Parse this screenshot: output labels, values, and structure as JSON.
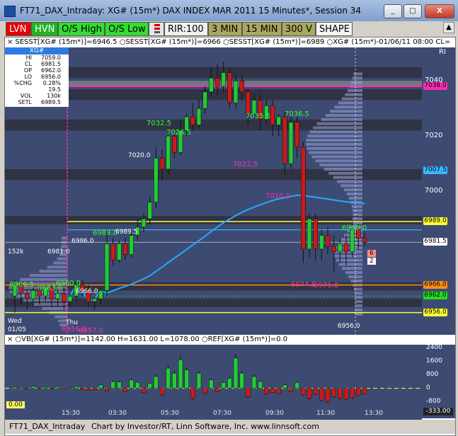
{
  "window": {
    "title": "FT71_DAX_Intraday: XG# (15m*) DAX INDEX MAR 2011 15 Minutes*, Session 34",
    "min_label": "_",
    "max_label": "□",
    "close_label": "X"
  },
  "toolbar": {
    "buttons": [
      "LVN",
      "HVN",
      "O/S High",
      "O/S Low",
      "RIR:100",
      "3 MIN",
      "15 MIN",
      "300 V",
      "SHAPE"
    ],
    "up_arrow": "▲"
  },
  "legend": {
    "close_x": "×",
    "text": "SESST[XG# (15m*)]=6946.5 ○SESST[XG# (15m*)]=6966 ○SESST[XG# (15m*)]=6989 ○XG# (15m*)-01/06/11 08:00 CL=",
    "ri_label": "RI"
  },
  "info": {
    "symbol": "XG#",
    "rows": [
      {
        "k": "HI",
        "v": "7059.0"
      },
      {
        "k": "CL",
        "v": "6981.5"
      },
      {
        "k": "OP",
        "v": "6962.0"
      },
      {
        "k": "LO",
        "v": "6956.0"
      },
      {
        "k": "%CHG",
        "v": "0.28%"
      },
      {
        "k": "",
        "v": "19.5"
      },
      {
        "k": "VOL",
        "v": "130k"
      },
      {
        "k": "SETL",
        "v": "6989.5"
      }
    ]
  },
  "price_axis": {
    "ticks": [
      "7040",
      "7020",
      "7000"
    ],
    "tags": [
      {
        "text": "7038.0",
        "color": "#ff2db4",
        "price": 7038
      },
      {
        "text": "7007.5",
        "color": "#3ab7ff",
        "price": 7007.5
      },
      {
        "text": "6989.0",
        "color": "#ffff33",
        "price": 6989
      },
      {
        "text": "6981.5",
        "color": "#ffffff",
        "price": 6981.5
      },
      {
        "text": "6966.0",
        "color": "#ff8c1a",
        "price": 6966
      },
      {
        "text": "6962.0",
        "color": "#22dd22",
        "price": 6962
      },
      {
        "text": "6956.0",
        "color": "#ffff33",
        "price": 6956
      }
    ]
  },
  "annotations": {
    "green": [
      "7026.5",
      "7032.5",
      "7035.5",
      "7036.5",
      "6989.0",
      "6966.5",
      "6963.0",
      "6960.0",
      "6989.0"
    ],
    "white": [
      "7020.0",
      "6989.5",
      "6986.0",
      "6981.0",
      "6966.0",
      "6956.0",
      "152k",
      "Wed",
      "01/05",
      "Thu"
    ],
    "magenta": [
      "7022.5",
      "7010.0",
      "6974.5",
      "6971.0",
      "6956.0",
      "6957.0"
    ],
    "bar_box": [
      "6",
      "2"
    ]
  },
  "lower_legend": {
    "text": "○VB[XG# (15m*)]=1142.00 H=1631.00 L=1078.00 ○REF[XG# (15m*)]=0.0"
  },
  "lower_axis": {
    "ticks": [
      "2400",
      "1600",
      "800",
      "0",
      "-800"
    ],
    "value_tag": "-333.00",
    "left_tag": "0.00"
  },
  "time_axis": {
    "labels": [
      "15:30",
      "03:30",
      "05:30",
      "07:30",
      "09:30",
      "11:30",
      "13:30"
    ]
  },
  "status": {
    "left": "FT71_DAX_Intraday",
    "right": "Chart by Investor/RT, Linn Software, Inc. www.linnsoft.com"
  },
  "colors": {
    "plot_bg": "#3d4b73",
    "up": "#22cc33",
    "down": "#cc1a1a",
    "vwap": "#27a9ff",
    "yellow_line": "#ffff33",
    "magenta_line": "#ff2db4",
    "orange_line": "#ff8c1a"
  },
  "chart_data": [
    {
      "type": "candlestick",
      "title": "XG# (15m*) DAX INDEX MAR 2011 15 Minutes*",
      "y_ticks": [
        7040,
        7020,
        7000
      ],
      "reference_levels": [
        7038.0,
        7007.5,
        6989.0,
        6981.5,
        6966.0,
        6962.0,
        6956.0
      ],
      "x_labels": [
        "15:30",
        "03:30",
        "05:30",
        "07:30",
        "09:30",
        "11:30",
        "13:30"
      ],
      "candles": [
        {
          "o": 6962,
          "c": 6966,
          "h": 6968,
          "l": 6956
        },
        {
          "o": 6966,
          "c": 6963,
          "h": 6967,
          "l": 6959
        },
        {
          "o": 6963,
          "c": 6961,
          "h": 6964,
          "l": 6957
        },
        {
          "o": 6961,
          "c": 6964,
          "h": 6965,
          "l": 6958
        },
        {
          "o": 6964,
          "c": 6962,
          "h": 6966,
          "l": 6959
        },
        {
          "o": 6962,
          "c": 6965,
          "h": 6966,
          "l": 6960
        },
        {
          "o": 6965,
          "c": 6961,
          "h": 6966,
          "l": 6958
        },
        {
          "o": 6961,
          "c": 6963,
          "h": 6964,
          "l": 6958
        },
        {
          "o": 6963,
          "c": 6960,
          "h": 6965,
          "l": 6957
        },
        {
          "o": 6960,
          "c": 6962,
          "h": 6963,
          "l": 6958
        },
        {
          "o": 6962,
          "c": 6966,
          "h": 6967,
          "l": 6960
        },
        {
          "o": 6966,
          "c": 6964,
          "h": 6968,
          "l": 6962
        },
        {
          "o": 6964,
          "c": 6960,
          "h": 6966,
          "l": 6958
        },
        {
          "o": 6960,
          "c": 6961,
          "h": 6962,
          "l": 6957
        },
        {
          "o": 6961,
          "c": 6964,
          "h": 6965,
          "l": 6959
        },
        {
          "o": 6964,
          "c": 6981,
          "h": 6986,
          "l": 6962
        },
        {
          "o": 6981,
          "c": 6975,
          "h": 6983,
          "l": 6973
        },
        {
          "o": 6975,
          "c": 6981,
          "h": 6982,
          "l": 6974
        },
        {
          "o": 6981,
          "c": 6977,
          "h": 6983,
          "l": 6975
        },
        {
          "o": 6977,
          "c": 6984,
          "h": 6986,
          "l": 6976
        },
        {
          "o": 6984,
          "c": 6987,
          "h": 6990,
          "l": 6982
        },
        {
          "o": 6987,
          "c": 6990,
          "h": 6992,
          "l": 6985
        },
        {
          "o": 6990,
          "c": 6996,
          "h": 6998,
          "l": 6988
        },
        {
          "o": 6996,
          "c": 7012,
          "h": 7016,
          "l": 6994
        },
        {
          "o": 7012,
          "c": 7008,
          "h": 7015,
          "l": 7004
        },
        {
          "o": 7008,
          "c": 7020,
          "h": 7022,
          "l": 7006
        },
        {
          "o": 7020,
          "c": 7014,
          "h": 7022,
          "l": 7012
        },
        {
          "o": 7014,
          "c": 7022,
          "h": 7026,
          "l": 7013
        },
        {
          "o": 7022,
          "c": 7027,
          "h": 7028,
          "l": 7020
        },
        {
          "o": 7027,
          "c": 7024,
          "h": 7032,
          "l": 7022
        },
        {
          "o": 7024,
          "c": 7030,
          "h": 7033,
          "l": 7023
        },
        {
          "o": 7030,
          "c": 7036,
          "h": 7038,
          "l": 7028
        },
        {
          "o": 7036,
          "c": 7041,
          "h": 7045,
          "l": 7034
        },
        {
          "o": 7041,
          "c": 7038,
          "h": 7046,
          "l": 7035
        },
        {
          "o": 7038,
          "c": 7043,
          "h": 7047,
          "l": 7036
        },
        {
          "o": 7043,
          "c": 7032,
          "h": 7045,
          "l": 7030
        },
        {
          "o": 7032,
          "c": 7040,
          "h": 7042,
          "l": 7030
        },
        {
          "o": 7040,
          "c": 7036,
          "h": 7042,
          "l": 7033
        },
        {
          "o": 7036,
          "c": 7028,
          "h": 7037,
          "l": 7024
        },
        {
          "o": 7028,
          "c": 7033,
          "h": 7035,
          "l": 7026
        },
        {
          "o": 7033,
          "c": 7026,
          "h": 7035,
          "l": 7022
        },
        {
          "o": 7026,
          "c": 7031,
          "h": 7033,
          "l": 7024
        },
        {
          "o": 7031,
          "c": 7024,
          "h": 7033,
          "l": 7020
        },
        {
          "o": 7024,
          "c": 7027,
          "h": 7028,
          "l": 7020
        },
        {
          "o": 7027,
          "c": 7010,
          "h": 7029,
          "l": 7006
        },
        {
          "o": 7010,
          "c": 7025,
          "h": 7027,
          "l": 7008
        },
        {
          "o": 7025,
          "c": 7016,
          "h": 7027,
          "l": 7012
        },
        {
          "o": 7016,
          "c": 6979,
          "h": 7018,
          "l": 6974
        },
        {
          "o": 6979,
          "c": 6990,
          "h": 6992,
          "l": 6976
        },
        {
          "o": 6990,
          "c": 6979,
          "h": 6992,
          "l": 6975
        },
        {
          "o": 6979,
          "c": 6984,
          "h": 6986,
          "l": 6975
        },
        {
          "o": 6984,
          "c": 6980,
          "h": 6987,
          "l": 6977
        },
        {
          "o": 6980,
          "c": 6978,
          "h": 6984,
          "l": 6971
        },
        {
          "o": 6978,
          "c": 6981,
          "h": 6983,
          "l": 6974
        },
        {
          "o": 6981,
          "c": 6978,
          "h": 6984,
          "l": 6973
        },
        {
          "o": 6978,
          "c": 6986,
          "h": 6989,
          "l": 6976
        },
        {
          "o": 6986,
          "c": 6983,
          "h": 6988,
          "l": 6979
        },
        {
          "o": 6983,
          "c": 6981.5,
          "h": 6985,
          "l": 6980
        }
      ]
    },
    {
      "type": "bar",
      "title": "VB[XG# (15m*)]",
      "values": [
        80,
        60,
        -50,
        120,
        -40,
        70,
        -30,
        90,
        -60,
        30,
        110,
        -80,
        -120,
        -90,
        200,
        -150,
        400,
        380,
        -200,
        500,
        350,
        -250,
        300,
        700,
        -400,
        1200,
        900,
        1700,
        1100,
        -600,
        900,
        -300,
        500,
        -200,
        350,
        600,
        1800,
        900,
        -500,
        700,
        400,
        -350,
        -250,
        -300,
        200,
        -200,
        350,
        -400,
        -600,
        -350,
        -700,
        -800,
        -500,
        -600,
        -650,
        -550,
        -400,
        -333
      ],
      "reference": 0.0,
      "y_ticks": [
        2400,
        1600,
        800,
        0,
        -800
      ]
    }
  ]
}
